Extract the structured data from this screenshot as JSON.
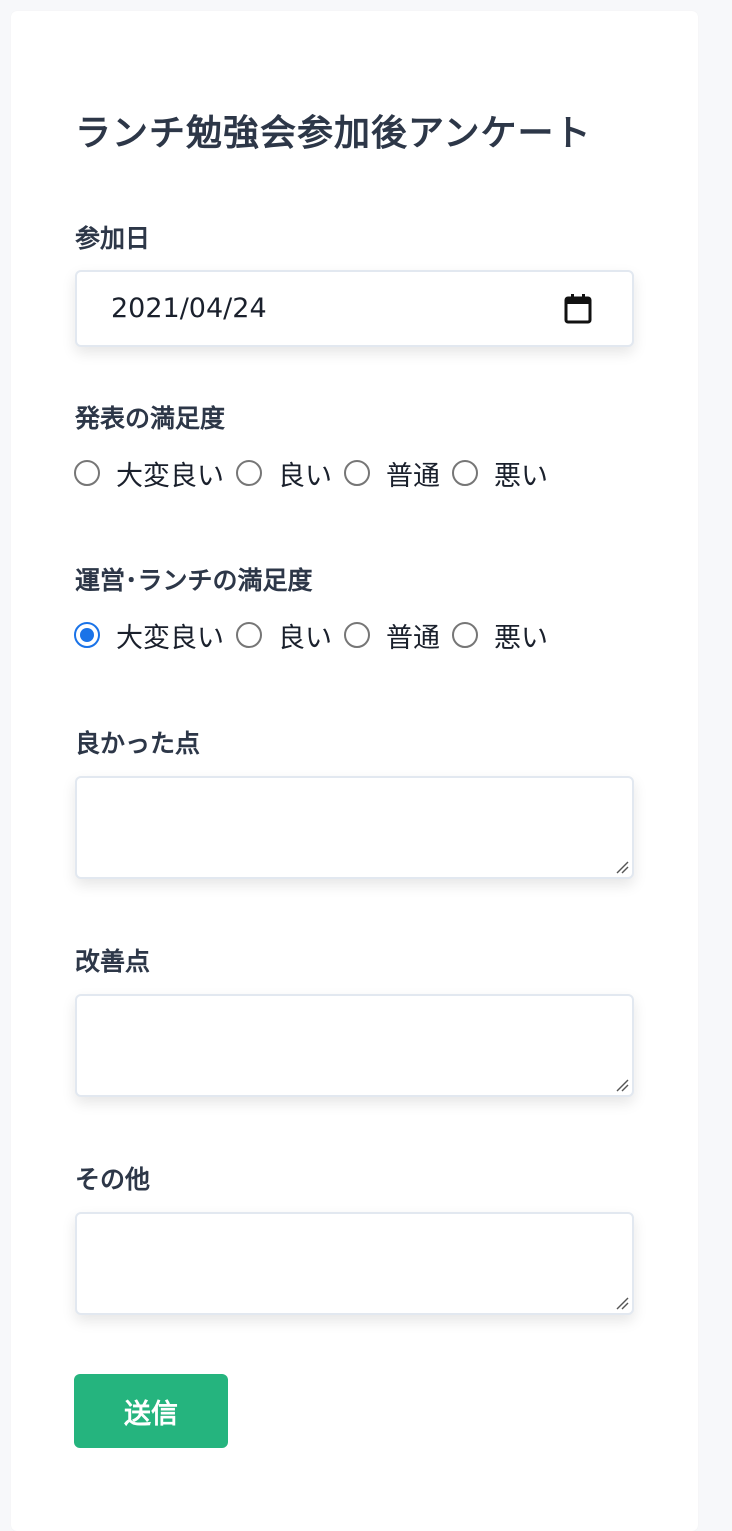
{
  "form": {
    "title": "ランチ勉強会参加後アンケート",
    "date": {
      "label": "参加日",
      "value": "2021/04/24",
      "icon": "calendar-icon"
    },
    "presentation_satisfaction": {
      "label": "発表の満足度",
      "options": [
        "大変良い",
        "良い",
        "普通",
        "悪い"
      ],
      "selected": null
    },
    "operation_satisfaction": {
      "label": "運営･ランチの満足度",
      "options": [
        "大変良い",
        "良い",
        "普通",
        "悪い"
      ],
      "selected": "大変良い"
    },
    "good_points": {
      "label": "良かった点",
      "value": ""
    },
    "improvements": {
      "label": "改善点",
      "value": ""
    },
    "other": {
      "label": "その他",
      "value": ""
    },
    "submit_label": "送信"
  },
  "colors": {
    "accent": "#25b47e",
    "radio_checked": "#1a73e8",
    "text": "#2d3748"
  }
}
